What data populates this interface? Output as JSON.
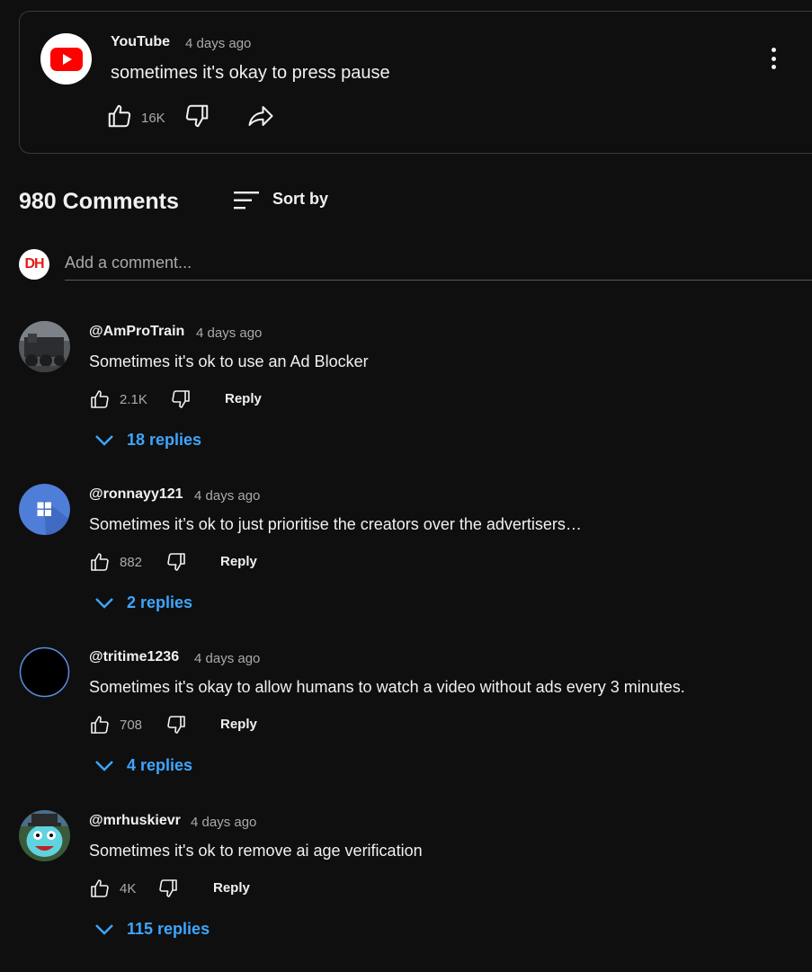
{
  "post": {
    "author": "YouTube",
    "time": "4 days ago",
    "text": "sometimes it's okay to press pause",
    "like_count": "16K",
    "brand_color": "#ff0000"
  },
  "comments_header": {
    "count_label": "980 Comments",
    "sort_label": "Sort by"
  },
  "add_comment": {
    "placeholder": "Add a comment...",
    "avatar_initials": "DH"
  },
  "comments": [
    {
      "author": "@AmProTrain",
      "time": "4 days ago",
      "text": "Sometimes it's ok to use an Ad Blocker",
      "likes": "2.1K",
      "reply_label": "Reply",
      "replies_label": "18 replies"
    },
    {
      "author": "@ronnayy121",
      "time": "4 days ago",
      "text": "Sometimes it’s ok to just prioritise the creators over the advertisers…",
      "likes": "882",
      "reply_label": "Reply",
      "replies_label": "2 replies"
    },
    {
      "author": "@tritime1236",
      "time": "4 days ago",
      "text": "Sometimes it's okay to allow humans to watch a video without ads every 3 minutes.",
      "likes": "708",
      "reply_label": "Reply",
      "replies_label": "4 replies"
    },
    {
      "author": "@mrhuskievr",
      "time": "4 days ago",
      "text": "Sometimes it's ok to remove ai age verification",
      "likes": "4K",
      "reply_label": "Reply",
      "replies_label": "115 replies"
    }
  ],
  "colors": {
    "background": "#0f0f0f",
    "text_primary": "#f1f1f1",
    "text_secondary": "#aaaaaa",
    "link_blue": "#3ea6ff"
  }
}
